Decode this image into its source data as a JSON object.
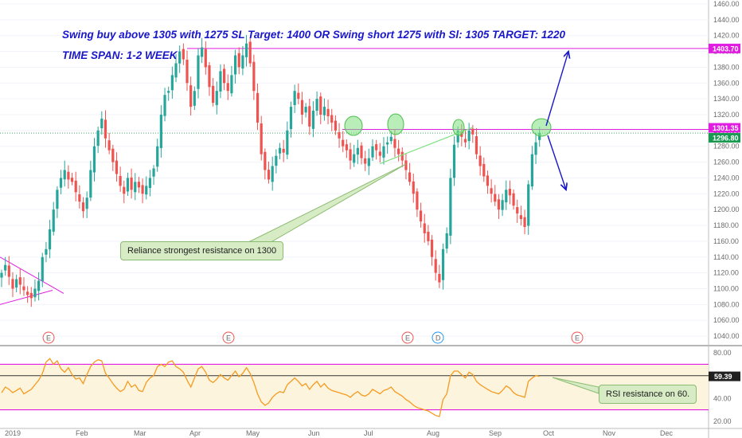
{
  "annotations": {
    "title": "Swing buy above 1305 with 1275 SL Target: 1400  OR Swing short 1275 with Sl: 1305 TARGET: 1220",
    "time_span": "TIME SPAN: 1-2 WEEK",
    "resistance_note": "Reliance strongest resistance on 1300",
    "rsi_note": "RSI resistance on 60."
  },
  "colors": {
    "up": "#26a69a",
    "down": "#ef5350",
    "magenta": "#e01de0",
    "arrow": "#1a17c9",
    "rsi": "#f59b1f",
    "highlight": "#7fe07f",
    "price_tag": "#1a9a50"
  },
  "chart_data": [
    {
      "type": "candlestick",
      "title": "",
      "x_axis": {
        "labels": [
          "2019",
          "Feb",
          "Mar",
          "Apr",
          "May",
          "Jun",
          "Jul",
          "Aug",
          "Sep",
          "Oct",
          "Nov",
          "Dec"
        ]
      },
      "y_axis": {
        "side": "right",
        "range": [
          1030,
          1465
        ],
        "ticks": [
          1040,
          1060,
          1080,
          1100,
          1120,
          1140,
          1160,
          1180,
          1200,
          1220,
          1240,
          1260,
          1280,
          1300,
          1320,
          1340,
          1360,
          1380,
          1400,
          1420,
          1440,
          1460
        ],
        "tick_labels": [
          "1040.00",
          "1060.00",
          "1080.00",
          "1100.00",
          "1120.00",
          "1140.00",
          "1160.00",
          "1180.00",
          "1200.00",
          "1220.00",
          "1240.00",
          "1260.00",
          "1280.00",
          "1300.00",
          "1320.00",
          "1340.00",
          "1360.00",
          "1380.00",
          "1400.00",
          "1420.00",
          "1440.00",
          "1460.00"
        ]
      },
      "price_labels": [
        {
          "value": 1403.7,
          "label": "1403.70",
          "kind": "target-line"
        },
        {
          "value": 1301.35,
          "label": "1301.35",
          "kind": "resistance-line"
        },
        {
          "value": 1296.8,
          "label": "1296.80",
          "kind": "last-price"
        }
      ],
      "earnings_markers": [
        "E",
        "E",
        "E",
        "D",
        "E"
      ],
      "closes": [
        1120,
        1130,
        1115,
        1100,
        1112,
        1105,
        1098,
        1092,
        1088,
        1100,
        1110,
        1140,
        1150,
        1175,
        1200,
        1225,
        1240,
        1250,
        1238,
        1235,
        1222,
        1210,
        1198,
        1215,
        1250,
        1280,
        1300,
        1315,
        1290,
        1275,
        1260,
        1245,
        1230,
        1220,
        1240,
        1225,
        1235,
        1228,
        1220,
        1230,
        1240,
        1252,
        1280,
        1320,
        1345,
        1350,
        1370,
        1385,
        1400,
        1390,
        1360,
        1330,
        1350,
        1395,
        1405,
        1380,
        1355,
        1335,
        1350,
        1375,
        1360,
        1350,
        1370,
        1395,
        1380,
        1395,
        1410,
        1385,
        1350,
        1310,
        1270,
        1250,
        1238,
        1255,
        1268,
        1278,
        1272,
        1300,
        1330,
        1350,
        1340,
        1320,
        1330,
        1305,
        1325,
        1340,
        1320,
        1330,
        1318,
        1310,
        1300,
        1290,
        1280,
        1275,
        1262,
        1270,
        1278,
        1265,
        1258,
        1265,
        1280,
        1275,
        1268,
        1280,
        1285,
        1292,
        1278,
        1270,
        1262,
        1250,
        1235,
        1220,
        1200,
        1185,
        1170,
        1160,
        1140,
        1120,
        1108,
        1150,
        1170,
        1240,
        1282,
        1300,
        1292,
        1285,
        1300,
        1295,
        1270,
        1255,
        1242,
        1230,
        1220,
        1210,
        1200,
        1212,
        1225,
        1218,
        1205,
        1195,
        1188,
        1178,
        1232,
        1270,
        1285,
        1296.8
      ],
      "overlays": [
        {
          "kind": "trend-line",
          "from_value": 1258,
          "to_value": 1304
        },
        {
          "kind": "horizontal",
          "value": 1403.7
        },
        {
          "kind": "horizontal",
          "value": 1301.35
        },
        {
          "kind": "arrow-up",
          "target_value": 1400
        },
        {
          "kind": "arrow-down",
          "target_value": 1225
        }
      ]
    },
    {
      "type": "line",
      "title": "",
      "y_axis": {
        "range": [
          15,
          85
        ],
        "ticks": [
          20,
          40,
          60,
          80
        ],
        "tick_labels": [
          "20.00",
          "40.00",
          "60.00",
          "80.00"
        ]
      },
      "bands": [
        70,
        30
      ],
      "last_value": {
        "value": 59.39,
        "label": "59.39"
      },
      "values": [
        45,
        50,
        48,
        45,
        47,
        49,
        44,
        46,
        48,
        52,
        56,
        62,
        72,
        75,
        70,
        73,
        66,
        63,
        67,
        61,
        57,
        58,
        53,
        61,
        68,
        72,
        74,
        73,
        62,
        58,
        53,
        49,
        46,
        48,
        55,
        50,
        52,
        47,
        46,
        54,
        58,
        60,
        68,
        70,
        68,
        72,
        73,
        68,
        66,
        63,
        56,
        50,
        58,
        66,
        68,
        63,
        56,
        54,
        57,
        61,
        58,
        56,
        60,
        64,
        59,
        62,
        67,
        62,
        54,
        44,
        37,
        34,
        36,
        41,
        44,
        46,
        45,
        52,
        55,
        58,
        55,
        51,
        53,
        48,
        52,
        55,
        50,
        53,
        49,
        47,
        46,
        45,
        44,
        43,
        41,
        44,
        46,
        43,
        42,
        44,
        48,
        46,
        44,
        47,
        48,
        50,
        46,
        44,
        42,
        39,
        37,
        34,
        32,
        31,
        30,
        29,
        27,
        25,
        24,
        39,
        44,
        60,
        64,
        64,
        61,
        58,
        63,
        61,
        55,
        52,
        50,
        48,
        46,
        45,
        44,
        47,
        51,
        49,
        45,
        43,
        42,
        41,
        55,
        58,
        60,
        59.39
      ]
    }
  ]
}
